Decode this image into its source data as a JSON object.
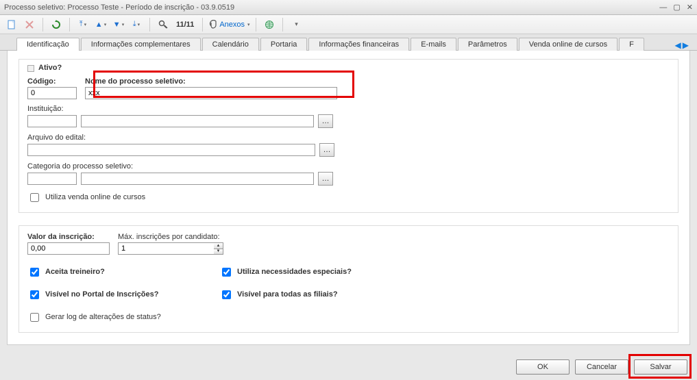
{
  "window": {
    "title": "Processo seletivo: Processo Teste - Período de inscrição - 03.9.0519"
  },
  "toolbar": {
    "counter": "11/11",
    "attachments_label": "Anexos"
  },
  "tabs": {
    "items": [
      {
        "label": "Identificação"
      },
      {
        "label": "Informações complementares"
      },
      {
        "label": "Calendário"
      },
      {
        "label": "Portaria"
      },
      {
        "label": "Informações financeiras"
      },
      {
        "label": "E-mails"
      },
      {
        "label": "Parâmetros"
      },
      {
        "label": "Venda online de cursos"
      },
      {
        "label": "F"
      }
    ],
    "active_index": 0
  },
  "form": {
    "ativo_label": "Ativo?",
    "codigo": {
      "label": "Código:",
      "value": "0"
    },
    "nome": {
      "label": "Nome do processo seletivo:",
      "value": "xxx"
    },
    "instituicao": {
      "label": "Instituição:",
      "code": "",
      "name": ""
    },
    "edital": {
      "label": "Arquivo do edital:",
      "value": ""
    },
    "categoria": {
      "label": "Categoria do processo seletivo:",
      "code": "",
      "name": ""
    },
    "venda_online": {
      "label": "Utiliza venda online de cursos",
      "checked": false
    },
    "valor": {
      "label": "Valor da inscrição:",
      "value": "0,00"
    },
    "max_insc": {
      "label": "Máx. inscrições por candidato:",
      "value": "1"
    },
    "opt1": {
      "label": "Aceita treineiro?",
      "checked": true
    },
    "opt2": {
      "label": "Utiliza necessidades especiais?",
      "checked": true
    },
    "opt3": {
      "label": "Visível no Portal de Inscrições?",
      "checked": true
    },
    "opt4": {
      "label": "Visível para todas as filiais?",
      "checked": true
    },
    "opt5": {
      "label": "Gerar log de alterações de status?",
      "checked": false
    }
  },
  "buttons": {
    "ok": "OK",
    "cancel": "Cancelar",
    "save": "Salvar"
  }
}
